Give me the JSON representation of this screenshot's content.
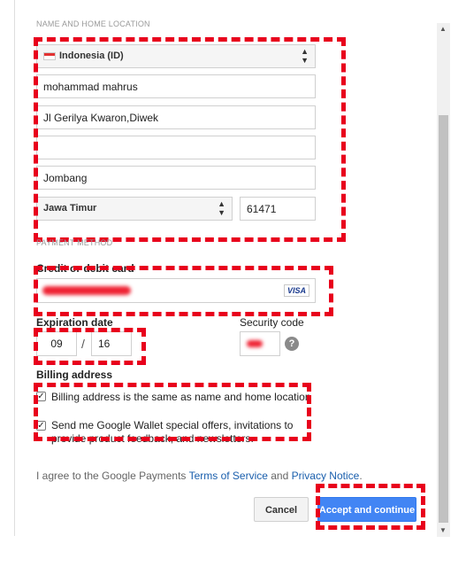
{
  "address": {
    "section_title": "NAME AND HOME LOCATION",
    "country": "Indonesia (ID)",
    "name": "mohammad mahrus",
    "address_line1": "Jl Gerilya Kwaron,Diwek",
    "address_line2": "",
    "city": "Jombang",
    "province": "Jawa Timur",
    "postal_code": "61471"
  },
  "payment": {
    "section_title": "PAYMENT METHOD",
    "card_label": "Credit or debit card",
    "card_brand": "VISA",
    "expiration_label": "Expiration date",
    "exp_month": "09",
    "exp_separator": "/",
    "exp_year": "16",
    "security_label": "Security code",
    "help_symbol": "?"
  },
  "billing": {
    "heading": "Billing address",
    "same_address_label": "Billing address is the same as name and home location",
    "offers_label": "Send me Google Wallet special offers, invitations to provide product feedback, and newsletters."
  },
  "terms": {
    "prefix": "I agree to the Google Payments ",
    "tos_link": "Terms of Service",
    "and": " and ",
    "privacy_link": "Privacy Notice",
    "suffix": "."
  },
  "actions": {
    "cancel": "Cancel",
    "accept": "Accept and continue"
  },
  "colors": {
    "accent": "#4285f4",
    "link": "#1a5fad",
    "annotation": "#e8001c"
  }
}
